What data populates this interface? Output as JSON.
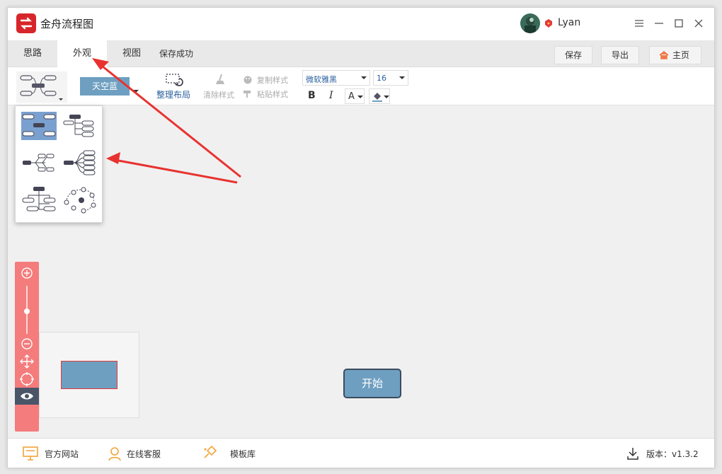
{
  "app": {
    "title": "金舟流程图",
    "username": "Lyan"
  },
  "tabs": [
    {
      "label": "思路"
    },
    {
      "label": "外观"
    },
    {
      "label": "视图"
    }
  ],
  "save_status": "保存成功",
  "top_buttons": {
    "save": "保存",
    "export": "导出",
    "home": "主页"
  },
  "toolbar": {
    "color_theme": "天空蓝",
    "tidy_layout": "整理布局",
    "clear_style": "清除样式",
    "copy_style": "复制样式",
    "paste_style": "粘贴样式",
    "font_family": "微软雅黑",
    "font_size": "16",
    "bold": "B",
    "italic": "I",
    "font_color": "A"
  },
  "canvas": {
    "start_node": "开始"
  },
  "footer": {
    "website": "官方网站",
    "support": "在线客服",
    "templates": "模板库",
    "version": "版本：v1.3.2"
  },
  "colors": {
    "accent": "#6e9fc1",
    "zoom_panel": "#f47c7c",
    "logo": "#d7262b",
    "arrow": "#e8322f"
  }
}
